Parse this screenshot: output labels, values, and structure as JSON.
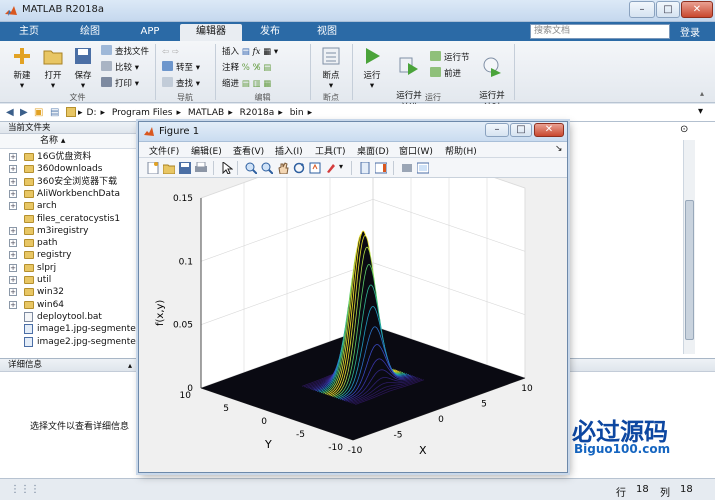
{
  "app": {
    "title": "MATLAB R2018a"
  },
  "tabs": [
    "主页",
    "绘图",
    "APP",
    "编辑器",
    "发布",
    "视图"
  ],
  "search": {
    "placeholder": "搜索文档"
  },
  "login": "登录",
  "ribbon": {
    "file_group": {
      "label": "文件",
      "new": "新建",
      "open": "打开",
      "save": "保存",
      "find_files": "查找文件",
      "compare": "比较",
      "print": "打印"
    },
    "nav_group": {
      "label": "导航",
      "goto": "转至",
      "find": "查找"
    },
    "edit_group": {
      "label": "编辑",
      "insert": "插入",
      "comment": "注释",
      "indent": "缩进"
    },
    "breakpoint_group": {
      "label": "断点",
      "breakpoints": "断点"
    },
    "run_group": {
      "label": "运行",
      "run": "运行",
      "run_advance": "运行并\n前进",
      "run_section": "运行节",
      "advance": "前进",
      "run_time": "运行并\n计时"
    }
  },
  "address": {
    "path": [
      "D:",
      "Program Files",
      "MATLAB",
      "R2018a",
      "bin"
    ]
  },
  "current_folder": {
    "header": "当前文件夹",
    "name_col": "名称",
    "items": [
      {
        "name": "16G优盘资料",
        "type": "folder",
        "expandable": true
      },
      {
        "name": "360downloads",
        "type": "folder",
        "expandable": true
      },
      {
        "name": "360安全浏览器下载",
        "type": "folder",
        "expandable": true
      },
      {
        "name": "AliWorkbenchData",
        "type": "folder",
        "expandable": true
      },
      {
        "name": "arch",
        "type": "folder",
        "expandable": true
      },
      {
        "name": "files_ceratocystis1",
        "type": "folder",
        "expandable": false
      },
      {
        "name": "m3iregistry",
        "type": "folder",
        "expandable": true
      },
      {
        "name": "path",
        "type": "folder",
        "expandable": true
      },
      {
        "name": "registry",
        "type": "folder",
        "expandable": true
      },
      {
        "name": "slprj",
        "type": "folder",
        "expandable": true
      },
      {
        "name": "util",
        "type": "folder",
        "expandable": true
      },
      {
        "name": "win32",
        "type": "folder",
        "expandable": true
      },
      {
        "name": "win64",
        "type": "folder",
        "expandable": true
      },
      {
        "name": "deploytool.bat",
        "type": "file",
        "expandable": false
      },
      {
        "name": "image1.jpg-segmente...",
        "type": "mfile",
        "expandable": false
      },
      {
        "name": "image2.jpg-segmente...",
        "type": "mfile",
        "expandable": false
      }
    ]
  },
  "details": {
    "header": "详细信息",
    "hint": "选择文件以查看详细信息"
  },
  "status": {
    "row_label": "行",
    "row": "18",
    "col_label": "列",
    "col": "18"
  },
  "watermark": {
    "text": "必过源码",
    "sub": "Biguo100.com"
  },
  "figure": {
    "title": "Figure 1",
    "menu": [
      "文件(F)",
      "编辑(E)",
      "查看(V)",
      "插入(I)",
      "工具(T)",
      "桌面(D)",
      "窗口(W)",
      "帮助(H)"
    ],
    "zlabel": "f(x,y)",
    "xlabel": "X",
    "ylabel": "Y",
    "zticks": [
      "0",
      "0.05",
      "0.1",
      "0.15"
    ],
    "xticks": [
      "-10",
      "-5",
      "0",
      "5",
      "10"
    ],
    "yticks": [
      "-10",
      "-5",
      "0",
      "5",
      "10"
    ]
  },
  "chart_data": {
    "type": "surface",
    "title": "",
    "xlabel": "X",
    "ylabel": "Y",
    "zlabel": "f(x,y)",
    "xlim": [
      -10,
      10
    ],
    "ylim": [
      -10,
      10
    ],
    "zlim": [
      0,
      0.15
    ],
    "peak": {
      "x": 0,
      "y": 0,
      "z": 0.12
    },
    "grid": true
  }
}
